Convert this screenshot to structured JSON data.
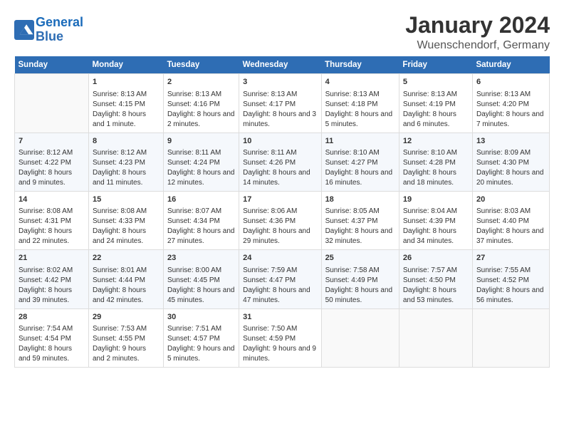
{
  "header": {
    "logo_line1": "General",
    "logo_line2": "Blue",
    "title": "January 2024",
    "subtitle": "Wuenschendorf, Germany"
  },
  "days_of_week": [
    "Sunday",
    "Monday",
    "Tuesday",
    "Wednesday",
    "Thursday",
    "Friday",
    "Saturday"
  ],
  "weeks": [
    [
      {
        "num": "",
        "empty": true
      },
      {
        "num": "1",
        "sunrise": "Sunrise: 8:13 AM",
        "sunset": "Sunset: 4:15 PM",
        "daylight": "Daylight: 8 hours and 1 minute."
      },
      {
        "num": "2",
        "sunrise": "Sunrise: 8:13 AM",
        "sunset": "Sunset: 4:16 PM",
        "daylight": "Daylight: 8 hours and 2 minutes."
      },
      {
        "num": "3",
        "sunrise": "Sunrise: 8:13 AM",
        "sunset": "Sunset: 4:17 PM",
        "daylight": "Daylight: 8 hours and 3 minutes."
      },
      {
        "num": "4",
        "sunrise": "Sunrise: 8:13 AM",
        "sunset": "Sunset: 4:18 PM",
        "daylight": "Daylight: 8 hours and 5 minutes."
      },
      {
        "num": "5",
        "sunrise": "Sunrise: 8:13 AM",
        "sunset": "Sunset: 4:19 PM",
        "daylight": "Daylight: 8 hours and 6 minutes."
      },
      {
        "num": "6",
        "sunrise": "Sunrise: 8:13 AM",
        "sunset": "Sunset: 4:20 PM",
        "daylight": "Daylight: 8 hours and 7 minutes."
      }
    ],
    [
      {
        "num": "7",
        "sunrise": "Sunrise: 8:12 AM",
        "sunset": "Sunset: 4:22 PM",
        "daylight": "Daylight: 8 hours and 9 minutes."
      },
      {
        "num": "8",
        "sunrise": "Sunrise: 8:12 AM",
        "sunset": "Sunset: 4:23 PM",
        "daylight": "Daylight: 8 hours and 11 minutes."
      },
      {
        "num": "9",
        "sunrise": "Sunrise: 8:11 AM",
        "sunset": "Sunset: 4:24 PM",
        "daylight": "Daylight: 8 hours and 12 minutes."
      },
      {
        "num": "10",
        "sunrise": "Sunrise: 8:11 AM",
        "sunset": "Sunset: 4:26 PM",
        "daylight": "Daylight: 8 hours and 14 minutes."
      },
      {
        "num": "11",
        "sunrise": "Sunrise: 8:10 AM",
        "sunset": "Sunset: 4:27 PM",
        "daylight": "Daylight: 8 hours and 16 minutes."
      },
      {
        "num": "12",
        "sunrise": "Sunrise: 8:10 AM",
        "sunset": "Sunset: 4:28 PM",
        "daylight": "Daylight: 8 hours and 18 minutes."
      },
      {
        "num": "13",
        "sunrise": "Sunrise: 8:09 AM",
        "sunset": "Sunset: 4:30 PM",
        "daylight": "Daylight: 8 hours and 20 minutes."
      }
    ],
    [
      {
        "num": "14",
        "sunrise": "Sunrise: 8:08 AM",
        "sunset": "Sunset: 4:31 PM",
        "daylight": "Daylight: 8 hours and 22 minutes."
      },
      {
        "num": "15",
        "sunrise": "Sunrise: 8:08 AM",
        "sunset": "Sunset: 4:33 PM",
        "daylight": "Daylight: 8 hours and 24 minutes."
      },
      {
        "num": "16",
        "sunrise": "Sunrise: 8:07 AM",
        "sunset": "Sunset: 4:34 PM",
        "daylight": "Daylight: 8 hours and 27 minutes."
      },
      {
        "num": "17",
        "sunrise": "Sunrise: 8:06 AM",
        "sunset": "Sunset: 4:36 PM",
        "daylight": "Daylight: 8 hours and 29 minutes."
      },
      {
        "num": "18",
        "sunrise": "Sunrise: 8:05 AM",
        "sunset": "Sunset: 4:37 PM",
        "daylight": "Daylight: 8 hours and 32 minutes."
      },
      {
        "num": "19",
        "sunrise": "Sunrise: 8:04 AM",
        "sunset": "Sunset: 4:39 PM",
        "daylight": "Daylight: 8 hours and 34 minutes."
      },
      {
        "num": "20",
        "sunrise": "Sunrise: 8:03 AM",
        "sunset": "Sunset: 4:40 PM",
        "daylight": "Daylight: 8 hours and 37 minutes."
      }
    ],
    [
      {
        "num": "21",
        "sunrise": "Sunrise: 8:02 AM",
        "sunset": "Sunset: 4:42 PM",
        "daylight": "Daylight: 8 hours and 39 minutes."
      },
      {
        "num": "22",
        "sunrise": "Sunrise: 8:01 AM",
        "sunset": "Sunset: 4:44 PM",
        "daylight": "Daylight: 8 hours and 42 minutes."
      },
      {
        "num": "23",
        "sunrise": "Sunrise: 8:00 AM",
        "sunset": "Sunset: 4:45 PM",
        "daylight": "Daylight: 8 hours and 45 minutes."
      },
      {
        "num": "24",
        "sunrise": "Sunrise: 7:59 AM",
        "sunset": "Sunset: 4:47 PM",
        "daylight": "Daylight: 8 hours and 47 minutes."
      },
      {
        "num": "25",
        "sunrise": "Sunrise: 7:58 AM",
        "sunset": "Sunset: 4:49 PM",
        "daylight": "Daylight: 8 hours and 50 minutes."
      },
      {
        "num": "26",
        "sunrise": "Sunrise: 7:57 AM",
        "sunset": "Sunset: 4:50 PM",
        "daylight": "Daylight: 8 hours and 53 minutes."
      },
      {
        "num": "27",
        "sunrise": "Sunrise: 7:55 AM",
        "sunset": "Sunset: 4:52 PM",
        "daylight": "Daylight: 8 hours and 56 minutes."
      }
    ],
    [
      {
        "num": "28",
        "sunrise": "Sunrise: 7:54 AM",
        "sunset": "Sunset: 4:54 PM",
        "daylight": "Daylight: 8 hours and 59 minutes."
      },
      {
        "num": "29",
        "sunrise": "Sunrise: 7:53 AM",
        "sunset": "Sunset: 4:55 PM",
        "daylight": "Daylight: 9 hours and 2 minutes."
      },
      {
        "num": "30",
        "sunrise": "Sunrise: 7:51 AM",
        "sunset": "Sunset: 4:57 PM",
        "daylight": "Daylight: 9 hours and 5 minutes."
      },
      {
        "num": "31",
        "sunrise": "Sunrise: 7:50 AM",
        "sunset": "Sunset: 4:59 PM",
        "daylight": "Daylight: 9 hours and 9 minutes."
      },
      {
        "num": "",
        "empty": true
      },
      {
        "num": "",
        "empty": true
      },
      {
        "num": "",
        "empty": true
      }
    ]
  ]
}
